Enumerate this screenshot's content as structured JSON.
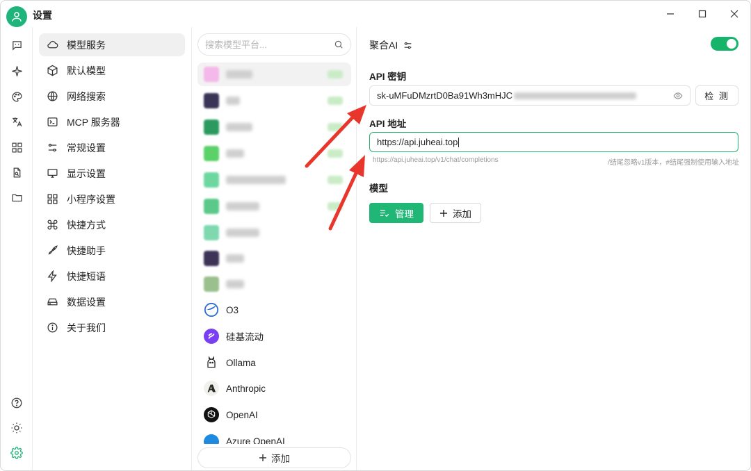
{
  "window": {
    "title": "设置"
  },
  "nav": {
    "items": [
      {
        "label": "模型服务",
        "icon": "cloud-icon",
        "active": true
      },
      {
        "label": "默认模型",
        "icon": "cube-icon"
      },
      {
        "label": "网络搜索",
        "icon": "globe-icon"
      },
      {
        "label": "MCP 服务器",
        "icon": "terminal-icon"
      },
      {
        "label": "常规设置",
        "icon": "sliders-icon"
      },
      {
        "label": "显示设置",
        "icon": "monitor-icon"
      },
      {
        "label": "小程序设置",
        "icon": "apps-icon"
      },
      {
        "label": "快捷方式",
        "icon": "command-icon"
      },
      {
        "label": "快捷助手",
        "icon": "rocket-icon"
      },
      {
        "label": "快捷短语",
        "icon": "zap-icon"
      },
      {
        "label": "数据设置",
        "icon": "drive-icon"
      },
      {
        "label": "关于我们",
        "icon": "info-icon"
      }
    ]
  },
  "providers": {
    "search_placeholder": "搜索模型平台...",
    "visible": [
      {
        "name": "O3"
      },
      {
        "name": "硅基流动"
      },
      {
        "name": "Ollama"
      },
      {
        "name": "Anthropic"
      },
      {
        "name": "OpenAI"
      },
      {
        "name": "Azure OpenAI"
      }
    ],
    "add_label": "添加"
  },
  "detail": {
    "provider_title": "聚合AI",
    "enabled": true,
    "api_key_label": "API 密钥",
    "api_key_value": "sk-uMFuDMzrtD0Ba91Wh3mHJC",
    "check_label": "检 测",
    "api_url_label": "API 地址",
    "api_url_value": "https://api.juheai.top",
    "url_hint_left": "https://api.juheai.top/v1/chat/completions",
    "url_hint_right": "/结尾忽略v1版本，#结尾强制使用输入地址",
    "models_label": "模型",
    "manage_label": "管理",
    "add_label": "添加"
  },
  "colors": {
    "accent": "#1fb676",
    "annotation": "#e8362c"
  }
}
